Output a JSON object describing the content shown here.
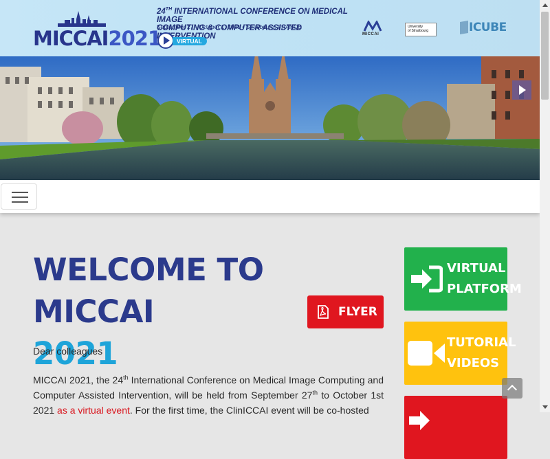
{
  "header": {
    "logo_text": "MICCAI",
    "logo_year": "2021",
    "conf_ordinal_num": "24",
    "conf_ordinal_suffix": "TH",
    "conf_title_line1": " INTERNATIONAL CONFERENCE ON MEDICAL IMAGE",
    "conf_title_line2": "COMPUTING & COMPUTER ASSISTED INTERVENTION",
    "conf_dates": "September 27 - October 1, 2021 • Strasbourg, FRANCE",
    "virtual_label": "VIRTUAL",
    "sponsors": {
      "miccai": "MICCAI",
      "unistra_line1": "University",
      "unistra_line2": "of Strasbourg",
      "icube": "ICUBE"
    }
  },
  "carousel": {
    "next_icon": "chevron-right-icon"
  },
  "navbar": {
    "toggle_icon": "hamburger-menu-icon"
  },
  "main": {
    "welcome_line1": "WELCOME TO MICCAI",
    "welcome_year": "2021",
    "flyer_label": "FLYER",
    "flyer_icon": "pdf-file-icon",
    "greeting": "Dear colleagues",
    "para": {
      "p1": "MICCAI 2021, the 24",
      "sup1": "th",
      "p2": " International Conference on Medical Image Computing and Computer Assisted Intervention, will be held from September 27",
      "sup2": "th",
      "p3": " to October 1st 2021 ",
      "link": "as a virtual event",
      "p4": ". For the first time, the ClinICCAI event will be co-hosted"
    }
  },
  "sidebar": {
    "virtual_line1": "VIRTUAL",
    "virtual_line2": "PLATFORM",
    "virtual_icon": "sign-in-icon",
    "tutorial_line1": "TUTORIAL",
    "tutorial_line2": "VIDEOS",
    "tutorial_icon": "video-camera-icon",
    "third_icon": "sign-in-icon"
  },
  "colors": {
    "navy": "#2b3a8c",
    "cyan": "#1ea4d9",
    "red": "#e0161f",
    "green": "#22b14c",
    "yellow": "#ffc20e",
    "page_bg": "#e6e6e6"
  }
}
